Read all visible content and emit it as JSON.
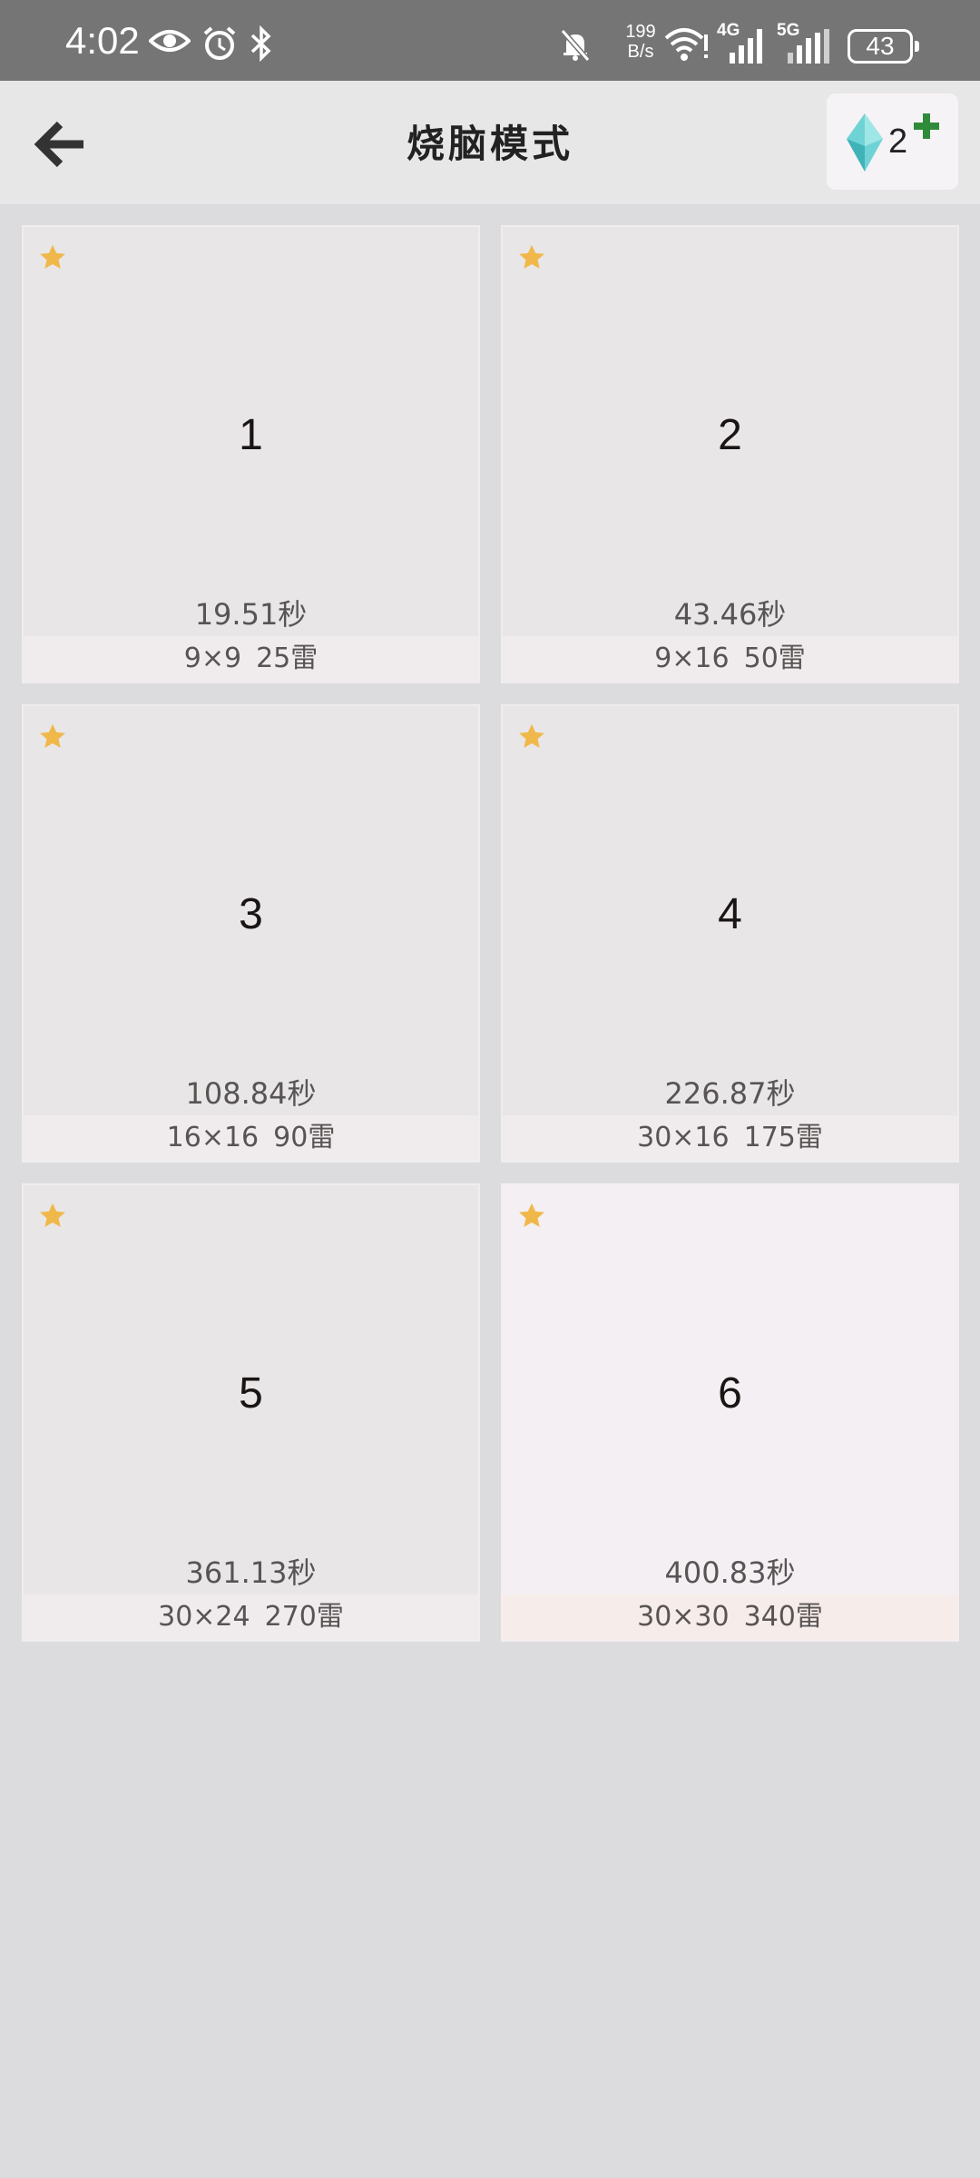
{
  "status_bar": {
    "time": "4:02",
    "net_speed_value": "199",
    "net_speed_unit": "B/s",
    "network_4g": "4G",
    "network_5g": "5G",
    "battery": "43"
  },
  "header": {
    "title": "烧脑模式",
    "gem_count": "2"
  },
  "colors": {
    "star": "#f0b84a",
    "gem": "#6fd3d6",
    "plus": "#2e8b3a"
  },
  "levels": [
    {
      "number": "1",
      "best_time": "19.51秒",
      "size": "9×9",
      "mines": "25雷"
    },
    {
      "number": "2",
      "best_time": "43.46秒",
      "size": "9×16",
      "mines": "50雷"
    },
    {
      "number": "3",
      "best_time": "108.84秒",
      "size": "16×16",
      "mines": "90雷"
    },
    {
      "number": "4",
      "best_time": "226.87秒",
      "size": "30×16",
      "mines": "175雷"
    },
    {
      "number": "5",
      "best_time": "361.13秒",
      "size": "30×24",
      "mines": "270雷"
    },
    {
      "number": "6",
      "best_time": "400.83秒",
      "size": "30×30",
      "mines": "340雷"
    }
  ]
}
